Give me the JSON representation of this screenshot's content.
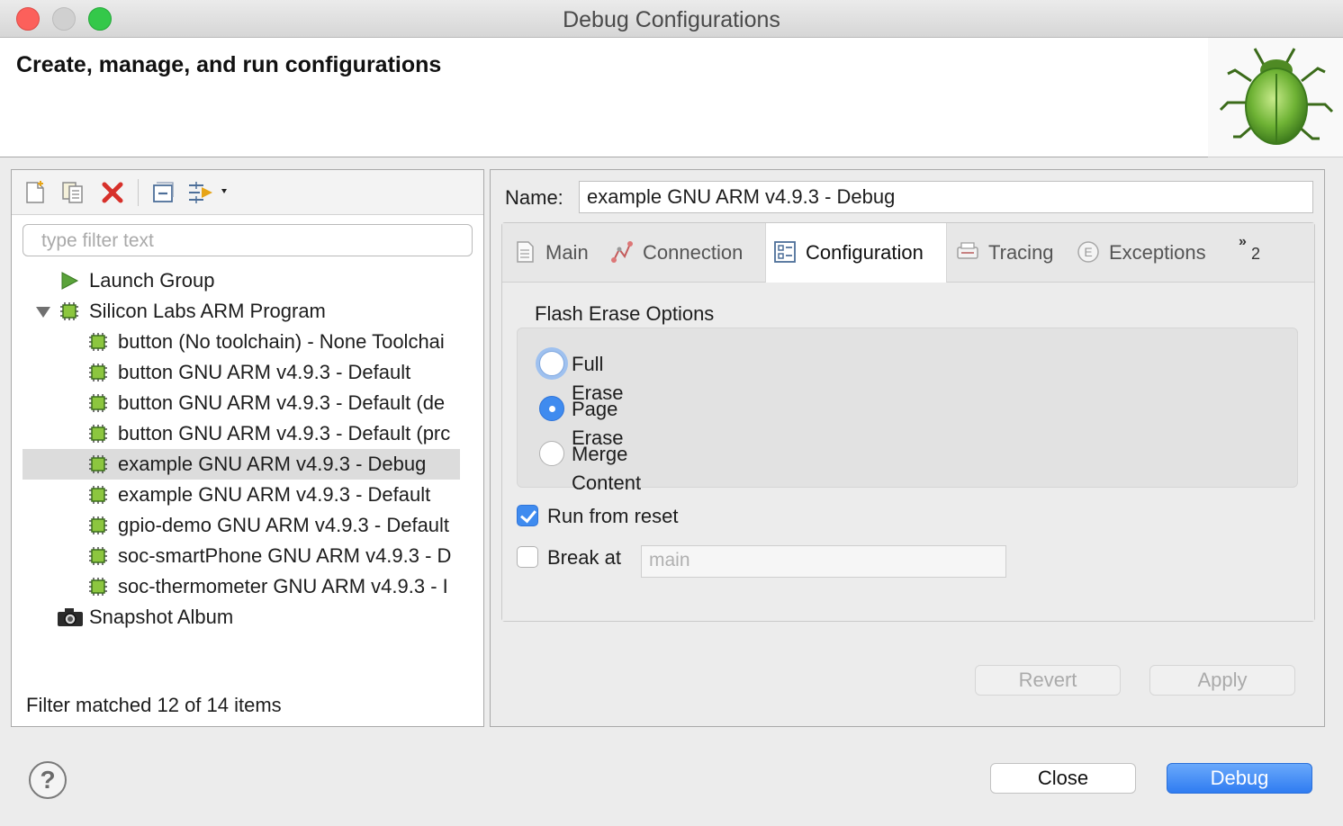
{
  "window": {
    "title": "Debug Configurations"
  },
  "banner": {
    "title": "Create, manage, and run configurations",
    "icon": "bug-icon"
  },
  "left": {
    "toolbar": [
      "new-config-icon",
      "duplicate-icon",
      "delete-icon",
      "collapse-all-icon",
      "filter-icon"
    ],
    "filter": {
      "placeholder": "type filter text",
      "value": ""
    },
    "tree": [
      {
        "label": "Launch Group",
        "icon": "launch-group-icon"
      },
      {
        "label": "Silicon Labs ARM Program",
        "icon": "chip-icon",
        "expanded": true
      },
      {
        "label": "button (No toolchain) - None Toolchai",
        "icon": "chip-icon"
      },
      {
        "label": "button GNU ARM v4.9.3 - Default",
        "icon": "chip-icon"
      },
      {
        "label": "button GNU ARM v4.9.3 - Default (de",
        "icon": "chip-icon"
      },
      {
        "label": "button GNU ARM v4.9.3 - Default (prc",
        "icon": "chip-icon"
      },
      {
        "label": "example GNU ARM v4.9.3 - Debug",
        "icon": "chip-icon",
        "selected": true
      },
      {
        "label": "example GNU ARM v4.9.3 - Default",
        "icon": "chip-icon"
      },
      {
        "label": "gpio-demo GNU ARM v4.9.3 - Default",
        "icon": "chip-icon"
      },
      {
        "label": "soc-smartPhone GNU ARM v4.9.3 - D",
        "icon": "chip-icon"
      },
      {
        "label": "soc-thermometer GNU ARM v4.9.3 - I",
        "icon": "chip-icon"
      },
      {
        "label": "Snapshot Album",
        "icon": "camera-icon"
      }
    ],
    "status": "Filter matched 12 of 14 items"
  },
  "right": {
    "name_label": "Name:",
    "name_value": "example GNU ARM v4.9.3 - Debug",
    "tabs": [
      {
        "label": "Main",
        "icon": "main-tab-icon"
      },
      {
        "label": "Connection",
        "icon": "connection-tab-icon"
      },
      {
        "label": "Configuration",
        "icon": "configuration-tab-icon",
        "active": true
      },
      {
        "label": "Tracing",
        "icon": "tracing-tab-icon"
      },
      {
        "label": "Exceptions",
        "icon": "exceptions-tab-icon"
      }
    ],
    "more_tabs": {
      "glyph": "»",
      "count": "2"
    },
    "flash": {
      "label": "Flash Erase Options",
      "options": [
        {
          "label": "Full Erase",
          "checked": false
        },
        {
          "label": "Page Erase",
          "checked": true
        },
        {
          "label": "Merge Content",
          "checked": false
        }
      ]
    },
    "run_from_reset": {
      "label": "Run from reset",
      "checked": true
    },
    "break_at": {
      "label": "Break at",
      "checked": false,
      "placeholder": "main"
    },
    "buttons": {
      "revert": "Revert",
      "apply": "Apply"
    }
  },
  "footer": {
    "help": "?",
    "close": "Close",
    "debug": "Debug"
  },
  "colors": {
    "accent": "#3f8bef",
    "chip": "#8cc63f"
  }
}
